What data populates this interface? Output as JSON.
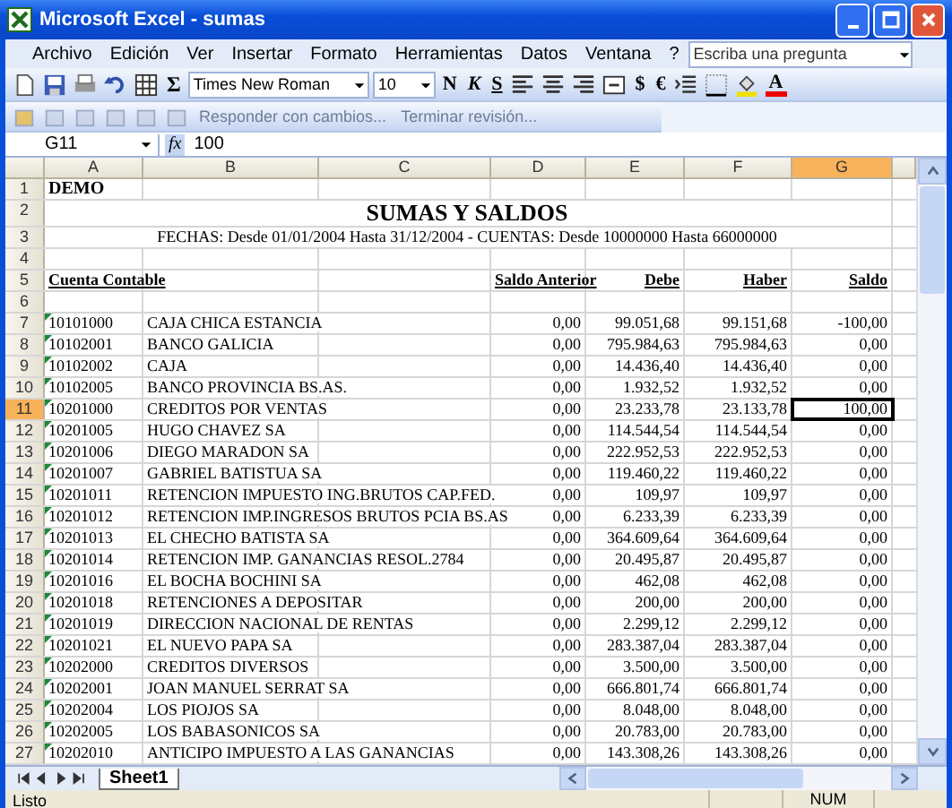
{
  "window": {
    "title": "Microsoft Excel - sumas"
  },
  "menu": [
    "Archivo",
    "Edición",
    "Ver",
    "Insertar",
    "Formato",
    "Herramientas",
    "Datos",
    "Ventana",
    "?"
  ],
  "search": {
    "placeholder": "Escriba una pregunta"
  },
  "toolbar": {
    "sum": "Σ",
    "font": "Times New Roman",
    "size": "10",
    "bold": "N",
    "italic": "K",
    "underline": "S",
    "currency": "$",
    "euro": "€",
    "color_letter": "A"
  },
  "review_toolbar": {
    "reply": "Responder con cambios...",
    "end": "Terminar revisión..."
  },
  "formula_bar": {
    "name_box": "G11",
    "fx": "fx",
    "formula": "100"
  },
  "columns": [
    {
      "label": "A",
      "selected": false
    },
    {
      "label": "B",
      "selected": false
    },
    {
      "label": "C",
      "selected": false
    },
    {
      "label": "D",
      "selected": false
    },
    {
      "label": "E",
      "selected": false
    },
    {
      "label": "F",
      "selected": false
    },
    {
      "label": "G",
      "selected": true
    }
  ],
  "sheet": {
    "rows": [
      {
        "number": "1",
        "kind": "label",
        "text": "DEMO"
      },
      {
        "number": "2",
        "kind": "title",
        "text": "SUMAS Y SALDOS"
      },
      {
        "number": "3",
        "kind": "subtitle",
        "text": "FECHAS: Desde 01/01/2004 Hasta 31/12/2004  -  CUENTAS: Desde 10000000 Hasta 66000000"
      },
      {
        "number": "4",
        "kind": "blank"
      },
      {
        "number": "5",
        "kind": "header",
        "account": "Cuenta Contable",
        "prev": "Saldo  Anterior",
        "debe": "Debe",
        "haber": "Haber",
        "saldo": "Saldo"
      },
      {
        "number": "6",
        "kind": "blank"
      },
      {
        "number": "7",
        "kind": "data",
        "selected": false,
        "account": "10101000",
        "name": "CAJA CHICA ESTANCIA",
        "prev": "0,00",
        "debe": "99.051,68",
        "haber": "99.151,68",
        "saldo": "-100,00"
      },
      {
        "number": "8",
        "kind": "data",
        "selected": false,
        "account": "10102001",
        "name": "BANCO GALICIA",
        "prev": "0,00",
        "debe": "795.984,63",
        "haber": "795.984,63",
        "saldo": "0,00"
      },
      {
        "number": "9",
        "kind": "data",
        "selected": false,
        "account": "10102002",
        "name": "CAJA",
        "prev": "0,00",
        "debe": "14.436,40",
        "haber": "14.436,40",
        "saldo": "0,00"
      },
      {
        "number": "10",
        "kind": "data",
        "selected": false,
        "account": "10102005",
        "name": "BANCO PROVINCIA BS.AS.",
        "prev": "0,00",
        "debe": "1.932,52",
        "haber": "1.932,52",
        "saldo": "0,00"
      },
      {
        "number": "11",
        "kind": "data",
        "selected": true,
        "account": "10201000",
        "name": "CREDITOS POR VENTAS",
        "prev": "0,00",
        "debe": "23.233,78",
        "haber": "23.133,78",
        "saldo": "100,00"
      },
      {
        "number": "12",
        "kind": "data",
        "selected": false,
        "account": "10201005",
        "name": "HUGO CHAVEZ SA",
        "prev": "0,00",
        "debe": "114.544,54",
        "haber": "114.544,54",
        "saldo": "0,00"
      },
      {
        "number": "13",
        "kind": "data",
        "selected": false,
        "account": "10201006",
        "name": "DIEGO MARADON SA",
        "prev": "0,00",
        "debe": "222.952,53",
        "haber": "222.952,53",
        "saldo": "0,00"
      },
      {
        "number": "14",
        "kind": "data",
        "selected": false,
        "account": "10201007",
        "name": "GABRIEL BATISTUA SA",
        "prev": "0,00",
        "debe": "119.460,22",
        "haber": "119.460,22",
        "saldo": "0,00"
      },
      {
        "number": "15",
        "kind": "data",
        "selected": false,
        "account": "10201011",
        "name": "RETENCION IMPUESTO ING.BRUTOS CAP.FED.",
        "prev": "0,00",
        "debe": "109,97",
        "haber": "109,97",
        "saldo": "0,00"
      },
      {
        "number": "16",
        "kind": "data",
        "selected": false,
        "account": "10201012",
        "name": "RETENCION IMP.INGRESOS BRUTOS PCIA BS.AS",
        "prev": "0,00",
        "debe": "6.233,39",
        "haber": "6.233,39",
        "saldo": "0,00"
      },
      {
        "number": "17",
        "kind": "data",
        "selected": false,
        "account": "10201013",
        "name": "EL CHECHO BATISTA SA",
        "prev": "0,00",
        "debe": "364.609,64",
        "haber": "364.609,64",
        "saldo": "0,00"
      },
      {
        "number": "18",
        "kind": "data",
        "selected": false,
        "account": "10201014",
        "name": "RETENCION IMP. GANANCIAS RESOL.2784",
        "prev": "0,00",
        "debe": "20.495,87",
        "haber": "20.495,87",
        "saldo": "0,00"
      },
      {
        "number": "19",
        "kind": "data",
        "selected": false,
        "account": "10201016",
        "name": "EL BOCHA BOCHINI SA",
        "prev": "0,00",
        "debe": "462,08",
        "haber": "462,08",
        "saldo": "0,00"
      },
      {
        "number": "20",
        "kind": "data",
        "selected": false,
        "account": "10201018",
        "name": "RETENCIONES A DEPOSITAR",
        "prev": "0,00",
        "debe": "200,00",
        "haber": "200,00",
        "saldo": "0,00"
      },
      {
        "number": "21",
        "kind": "data",
        "selected": false,
        "account": "10201019",
        "name": "DIRECCION NACIONAL DE RENTAS",
        "prev": "0,00",
        "debe": "2.299,12",
        "haber": "2.299,12",
        "saldo": "0,00"
      },
      {
        "number": "22",
        "kind": "data",
        "selected": false,
        "account": "10201021",
        "name": "EL NUEVO PAPA SA",
        "prev": "0,00",
        "debe": "283.387,04",
        "haber": "283.387,04",
        "saldo": "0,00"
      },
      {
        "number": "23",
        "kind": "data",
        "selected": false,
        "account": "10202000",
        "name": "CREDITOS DIVERSOS",
        "prev": "0,00",
        "debe": "3.500,00",
        "haber": "3.500,00",
        "saldo": "0,00"
      },
      {
        "number": "24",
        "kind": "data",
        "selected": false,
        "account": "10202001",
        "name": "JOAN MANUEL SERRAT SA",
        "prev": "0,00",
        "debe": "666.801,74",
        "haber": "666.801,74",
        "saldo": "0,00"
      },
      {
        "number": "25",
        "kind": "data",
        "selected": false,
        "account": "10202004",
        "name": "LOS PIOJOS SA",
        "prev": "0,00",
        "debe": "8.048,00",
        "haber": "8.048,00",
        "saldo": "0,00"
      },
      {
        "number": "26",
        "kind": "data",
        "selected": false,
        "account": "10202005",
        "name": "LOS BABASONICOS SA",
        "prev": "0,00",
        "debe": "20.783,00",
        "haber": "20.783,00",
        "saldo": "0,00"
      },
      {
        "number": "27",
        "kind": "data",
        "selected": false,
        "account": "10202010",
        "name": "ANTICIPO IMPUESTO A LAS GANANCIAS",
        "prev": "0,00",
        "debe": "143.308,26",
        "haber": "143.308,26",
        "saldo": "0,00"
      }
    ]
  },
  "sheet_tabs": [
    {
      "label": "Sheet1",
      "selected": true
    }
  ],
  "status_bar": {
    "text": "Listo",
    "num": "NUM"
  }
}
